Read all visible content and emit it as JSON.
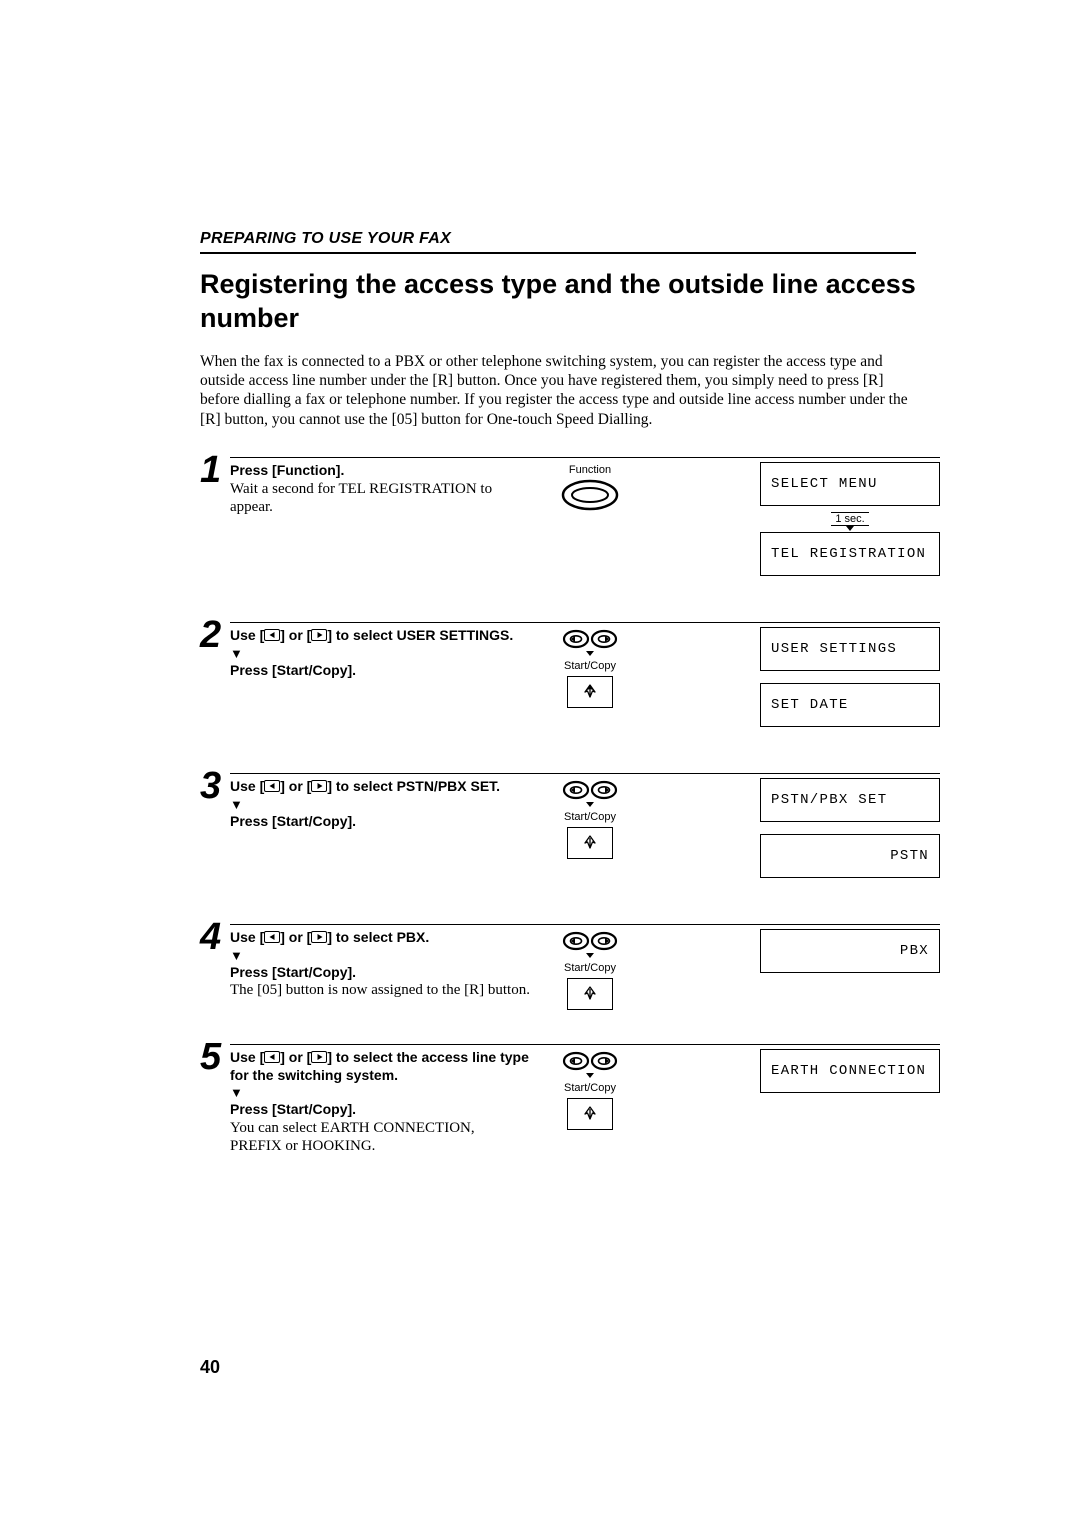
{
  "header": {
    "section": "PREPARING TO USE YOUR FAX",
    "title": "Registering the access type and the outside line access number"
  },
  "intro": "When the fax is connected to a PBX or other telephone switching system, you can register the access type and outside access line number under the [R] button. Once you have registered them, you simply need to press [R] before dialling a fax or telephone number. If you register the access type and outside line access number under the [R] button, you cannot use the [05] button for One-touch Speed Dialling.",
  "labels": {
    "function": "Function",
    "start_copy": "Start/Copy",
    "wait_1sec": "1 sec."
  },
  "steps": [
    {
      "num": "1",
      "bold1": "Press [Function].",
      "plain1": "Wait a second for TEL REGISTRATION to appear.",
      "icon": "function",
      "lcd": [
        "SELECT MENU",
        "TEL REGISTRATION"
      ],
      "wait_between": true
    },
    {
      "num": "2",
      "bold1_pre": "Use [",
      "bold1_mid": "] or [",
      "bold1_post": "] to select USER SETTINGS.",
      "bold2": "Press [Start/Copy].",
      "icon": "nav-start",
      "lcd": [
        "USER SETTINGS",
        "SET DATE"
      ]
    },
    {
      "num": "3",
      "bold1_pre": "Use [",
      "bold1_mid": "] or [",
      "bold1_post": "] to select PSTN/PBX SET.",
      "bold2": "Press [Start/Copy].",
      "icon": "nav-start",
      "lcd": [
        "PSTN/PBX SET",
        "PSTN"
      ],
      "lcd_align": [
        "left",
        "right"
      ]
    },
    {
      "num": "4",
      "bold1_pre": "Use [",
      "bold1_mid": "] or [",
      "bold1_post": "] to select PBX.",
      "bold2": "Press [Start/Copy].",
      "plain2": "The [05] button is now assigned to the [R] button.",
      "icon": "nav-start",
      "lcd": [
        "PBX"
      ],
      "lcd_align": [
        "right"
      ]
    },
    {
      "num": "5",
      "bold1_pre": "Use [",
      "bold1_mid": "] or [",
      "bold1_post": "] to select the access line type for the switching system.",
      "bold2": "Press [Start/Copy].",
      "plain2": "You can select EARTH CONNECTION, PREFIX or HOOKING.",
      "icon": "nav-start",
      "lcd": [
        "EARTH CONNECTION"
      ]
    }
  ],
  "page_number": "40"
}
